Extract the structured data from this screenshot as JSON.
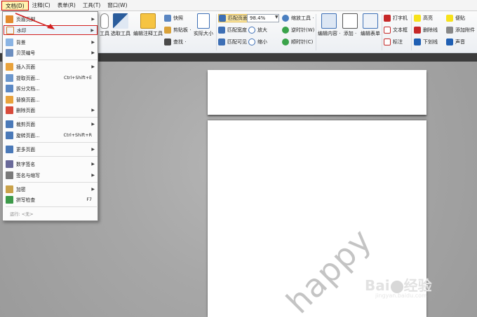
{
  "menubar": [
    {
      "label": "文档(D)",
      "active": true
    },
    {
      "label": "注释(C)"
    },
    {
      "label": "表单(R)"
    },
    {
      "label": "工具(T)"
    },
    {
      "label": "窗口(W)"
    }
  ],
  "ribbon": {
    "tools": [
      "选取工具",
      "编辑注释工具",
      "实际大小"
    ],
    "snapshot": "快照",
    "clipboard": "剪贴板 ·",
    "find": "查找 ·",
    "fit_page": "匹配页面",
    "fit_width": "匹配宽度",
    "fit_visible": "匹配可见",
    "zoom_value": "98.4%",
    "zoom_tool": "缩放工具 ·",
    "zoom_in": "放大",
    "zoom_out": "缩小",
    "rotate_ccw": "逆时针(W)",
    "rotate_cw": "顺时针(C)",
    "edit_content": "编辑内容 ·",
    "add": "添加 ·",
    "edit_form": "编辑表单",
    "typewriter": "打字机",
    "textbox": "文本框",
    "callout": "标注",
    "highlight": "高亮",
    "strikeout": "删除线",
    "underline": "下划线",
    "note": "便贴",
    "attach": "添加附件",
    "sound": "声音"
  },
  "dropdown": {
    "items": [
      {
        "label": "页眉页脚",
        "arrow": true
      },
      {
        "label": "水印",
        "arrow": true,
        "highlight": true
      },
      {
        "label": "背景",
        "arrow": true
      },
      {
        "label": "贝茨编号",
        "arrow": true
      },
      {
        "label": "插入页面",
        "arrow": true
      },
      {
        "label": "提取页面...",
        "shortcut": "Ctrl+Shift+E"
      },
      {
        "label": "拆分文档..."
      },
      {
        "label": "替换页面..."
      },
      {
        "label": "删除页面",
        "arrow": true
      },
      {
        "label": "裁剪页面",
        "arrow": true
      },
      {
        "label": "旋转页面...",
        "shortcut": "Ctrl+Shift+R"
      },
      {
        "label": "更多页面",
        "arrow": true
      },
      {
        "label": "数字签名",
        "arrow": true
      },
      {
        "label": "签名与缩写",
        "arrow": true
      },
      {
        "label": "加密",
        "arrow": true
      },
      {
        "label": "拼写检查",
        "shortcut": "F7"
      }
    ],
    "status": "运行: <无>"
  },
  "document": {
    "watermark": "happy"
  },
  "watermark_logo": {
    "brand_left": "Bai",
    "brand_right": "经验",
    "url": "jingyan.baidu.com"
  },
  "colors": {
    "highlight_border": "#d21f1f",
    "menu_active_bg": "#fff3b0",
    "workspace_bg": "#a7a7a7"
  }
}
